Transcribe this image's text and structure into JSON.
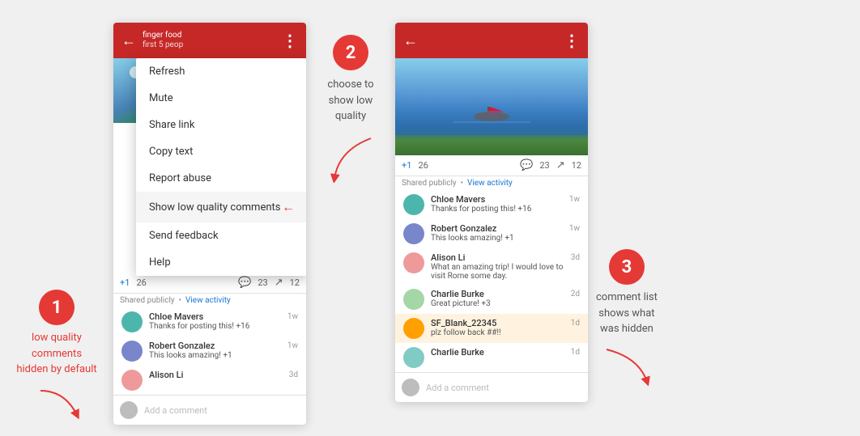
{
  "background_color": "#f0f0f0",
  "accent_color": "#e53935",
  "steps": [
    {
      "number": "1",
      "label": "low quality comments\nhidden by default"
    },
    {
      "number": "2",
      "label": "choose to\nshow low\nquality"
    },
    {
      "number": "3",
      "label": "comment list\nshows what\nwas hidden"
    }
  ],
  "phone1": {
    "header": {
      "back_icon": "←",
      "title_lines": [
        "finger food",
        "first 5 peop"
      ],
      "more_icon": "⋮"
    },
    "image_alt": "landscape photo",
    "engagement": {
      "plusone": "+1",
      "plusone_count": "26",
      "comment_icon": "💬",
      "comment_count": "23",
      "share_icon": "↗",
      "share_count": "12"
    },
    "shared_text": "Shared publicly",
    "view_activity": "View activity",
    "comments": [
      {
        "name": "Chloe Mavers",
        "text": "Thanks for posting this! +16",
        "time": "1w",
        "avatar_color": "#4db6ac"
      },
      {
        "name": "Robert Gonzalez",
        "text": "This looks amazing! +1",
        "time": "1w",
        "avatar_color": "#7986cb"
      },
      {
        "name": "Alison Li",
        "text": "",
        "time": "3d",
        "avatar_color": "#ef9a9a"
      }
    ],
    "add_comment_placeholder": "Add a comment"
  },
  "dropdown": {
    "items": [
      {
        "label": "Refresh",
        "highlighted": false
      },
      {
        "label": "Mute",
        "highlighted": false
      },
      {
        "label": "Share link",
        "highlighted": false
      },
      {
        "label": "Copy text",
        "highlighted": false
      },
      {
        "label": "Report abuse",
        "highlighted": false
      },
      {
        "label": "Show low quality comments",
        "highlighted": true
      },
      {
        "label": "Send feedback",
        "highlighted": false
      },
      {
        "label": "Help",
        "highlighted": false
      }
    ]
  },
  "phone2": {
    "header": {
      "back_icon": "←",
      "more_icon": "⋮"
    },
    "image_alt": "river canal photo with boat",
    "engagement": {
      "plusone": "+1",
      "plusone_count": "26",
      "comment_count": "23",
      "share_count": "12"
    },
    "shared_text": "Shared publicly",
    "view_activity": "View activity",
    "comments": [
      {
        "name": "Chloe Mavers",
        "text": "Thanks for posting this! +16",
        "time": "1w",
        "avatar_color": "#4db6ac"
      },
      {
        "name": "Robert Gonzalez",
        "text": "This looks amazing! +1",
        "time": "1w",
        "avatar_color": "#7986cb"
      },
      {
        "name": "Alison Li",
        "text": "What an amazing trip! I would love to visit Rome some day.",
        "time": "3d",
        "avatar_color": "#ef9a9a"
      },
      {
        "name": "Charlie Burke",
        "text": "Great picture! +3",
        "time": "2d",
        "avatar_color": "#a5d6a7"
      },
      {
        "name": "SF_Blank_22345",
        "text": "plz follow back ##!!",
        "time": "1d",
        "avatar_color": "#ffcc02",
        "highlighted": true
      },
      {
        "name": "Charlie Burke",
        "text": "",
        "time": "1d",
        "avatar_color": "#80cbc4"
      }
    ],
    "add_comment_placeholder": "Add a comment"
  }
}
